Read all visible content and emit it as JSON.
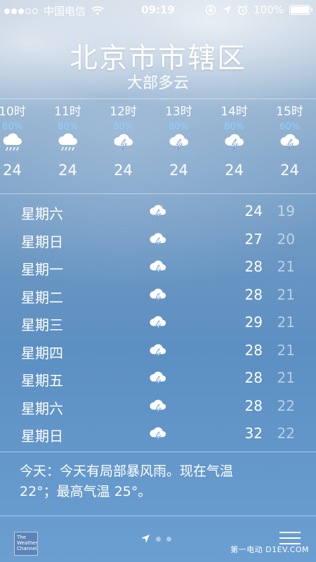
{
  "status_bar": {
    "carrier": "中国电信",
    "time": "09:19",
    "battery": "100%"
  },
  "location": {
    "city": "北京市市辖区",
    "condition": "大部多云"
  },
  "hourly": [
    {
      "time": "10时",
      "precip": "80%",
      "icon": "rain-icon",
      "temp": "24"
    },
    {
      "time": "11时",
      "precip": "80%",
      "icon": "rain-icon",
      "temp": "24"
    },
    {
      "time": "12时",
      "precip": "80%",
      "icon": "thunderstorm-icon",
      "temp": "24"
    },
    {
      "time": "13时",
      "precip": "80%",
      "icon": "thunderstorm-icon",
      "temp": "24"
    },
    {
      "time": "14时",
      "precip": "80%",
      "icon": "thunderstorm-icon",
      "temp": "24"
    },
    {
      "time": "15时",
      "precip": "60%",
      "icon": "thunderstorm-icon",
      "temp": "24"
    }
  ],
  "daily": [
    {
      "day": "星期六",
      "icon": "thunderstorm-icon",
      "high": "24",
      "low": "19"
    },
    {
      "day": "星期日",
      "icon": "thunderstorm-icon",
      "high": "27",
      "low": "20"
    },
    {
      "day": "星期一",
      "icon": "thunderstorm-icon",
      "high": "28",
      "low": "21"
    },
    {
      "day": "星期二",
      "icon": "thunderstorm-icon",
      "high": "28",
      "low": "21"
    },
    {
      "day": "星期三",
      "icon": "thunderstorm-icon",
      "high": "29",
      "low": "21"
    },
    {
      "day": "星期四",
      "icon": "thunderstorm-icon",
      "high": "28",
      "low": "21"
    },
    {
      "day": "星期五",
      "icon": "thunderstorm-icon",
      "high": "28",
      "low": "21"
    },
    {
      "day": "星期六",
      "icon": "thunderstorm-icon",
      "high": "28",
      "low": "22"
    },
    {
      "day": "星期日",
      "icon": "thunderstorm-icon",
      "high": "32",
      "low": "22"
    }
  ],
  "summary": {
    "line1": "今天：今天有局部暴风雨。现在气温",
    "line2": "22°；最高气温 25°。"
  },
  "bottom_bar": {
    "logo_text": "The Weather Channel",
    "watermark": "第一电动 D1EV.COM"
  },
  "colors": {
    "precip_text": "#8fd0ff"
  }
}
